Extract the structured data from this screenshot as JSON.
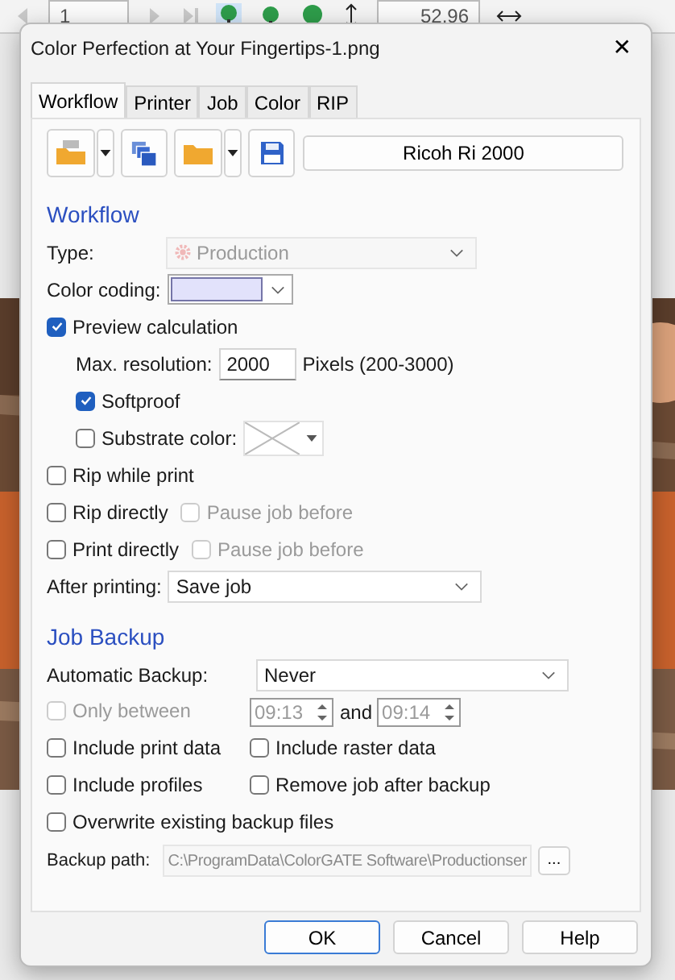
{
  "toolbar": {
    "page": "1",
    "zoom": "52.96"
  },
  "window": {
    "title": "Color Perfection at Your Fingertips-1.png",
    "close": "✕"
  },
  "tabs": [
    {
      "label": "Workflow",
      "selected": true
    },
    {
      "label": "Printer",
      "selected": false
    },
    {
      "label": "Job",
      "selected": false
    },
    {
      "label": "Color",
      "selected": false
    },
    {
      "label": "RIP",
      "selected": false
    }
  ],
  "printer": {
    "name": "Ricoh Ri 2000"
  },
  "workflow": {
    "heading": "Workflow",
    "type": {
      "label": "Type:",
      "value": "Production",
      "disabled": true
    },
    "color_coding": {
      "label": "Color coding:",
      "color": "#e2e2fb"
    },
    "preview": {
      "label": "Preview calculation",
      "checked": true
    },
    "max_resolution": {
      "label": "Max. resolution:",
      "value": "2000",
      "unit": "Pixels (200-3000)"
    },
    "softproof": {
      "label": "Softproof",
      "checked": true
    },
    "substrate": {
      "label": "Substrate color:",
      "checked": false
    },
    "rip_while_print": {
      "label": "Rip while print",
      "checked": false
    },
    "rip_directly": {
      "label": "Rip directly",
      "checked": false,
      "pause": {
        "label": "Pause job before",
        "checked": false,
        "disabled": true
      }
    },
    "print_directly": {
      "label": "Print directly",
      "checked": false,
      "pause": {
        "label": "Pause job before",
        "checked": false,
        "disabled": true
      }
    },
    "after_printing": {
      "label": "After printing:",
      "value": "Save job"
    }
  },
  "job_backup": {
    "heading": "Job Backup",
    "automatic": {
      "label": "Automatic Backup:",
      "value": "Never"
    },
    "only_between": {
      "label": "Only between",
      "checked": false,
      "disabled": true,
      "from": "09:13",
      "and": "and",
      "to": "09:14"
    },
    "options": [
      [
        {
          "label": "Include print data",
          "checked": false
        },
        {
          "label": "Include raster data",
          "checked": false
        }
      ],
      [
        {
          "label": "Include profiles",
          "checked": false
        },
        {
          "label": "Remove job after backup",
          "checked": false
        }
      ],
      [
        {
          "label": "Overwrite existing backup files",
          "checked": false
        }
      ]
    ],
    "path": {
      "label": "Backup path:",
      "value": "C:\\ProgramData\\ColorGATE Software\\Productionser",
      "browse": "..."
    }
  },
  "buttons": [
    {
      "label": "OK",
      "selected": true
    },
    {
      "label": "Cancel",
      "selected": false
    },
    {
      "label": "Help",
      "selected": false
    }
  ]
}
